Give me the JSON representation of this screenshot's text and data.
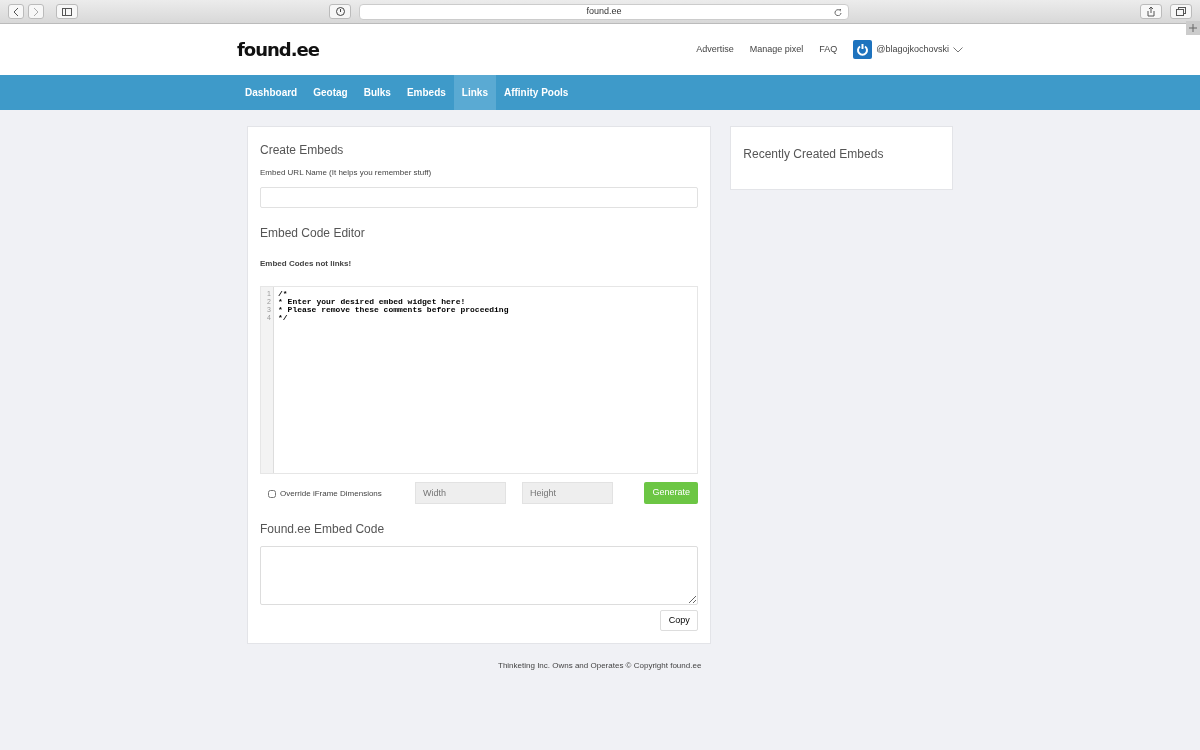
{
  "browser": {
    "url": "found.ee"
  },
  "header": {
    "logo": "found.ee",
    "links": [
      "Advertise",
      "Manage pixel",
      "FAQ"
    ],
    "user": "@blagojkochovski"
  },
  "nav": [
    {
      "label": "Dashboard",
      "selected": false
    },
    {
      "label": "Geotag",
      "selected": false
    },
    {
      "label": "Bulks",
      "selected": false
    },
    {
      "label": "Embeds",
      "selected": false
    },
    {
      "label": "Links",
      "selected": true
    },
    {
      "label": "Affinity Pools",
      "selected": false
    }
  ],
  "create": {
    "title": "Create Embeds",
    "url_label": "Embed URL Name (It helps you remember stuff)",
    "editor_title": "Embed Code Editor",
    "editor_note": "Embed Codes not links!",
    "code_lines": [
      {
        "number": "1",
        "text": "/*"
      },
      {
        "number": "2",
        "text": "* Enter your desired embed widget here!"
      },
      {
        "number": "3",
        "text": "* Please remove these comments before proceeding"
      },
      {
        "number": "4",
        "text": "*/"
      }
    ],
    "override": {
      "label": "Override iFrame Dimensions",
      "checked": false
    },
    "width_placeholder": "Width",
    "height_placeholder": "Height",
    "generate": "Generate",
    "output_title": "Found.ee Embed Code",
    "copy": "Copy"
  },
  "recent": {
    "title": "Recently Created Embeds"
  },
  "footer": "Thinketing Inc. Owns and Operates © Copyright found.ee"
}
